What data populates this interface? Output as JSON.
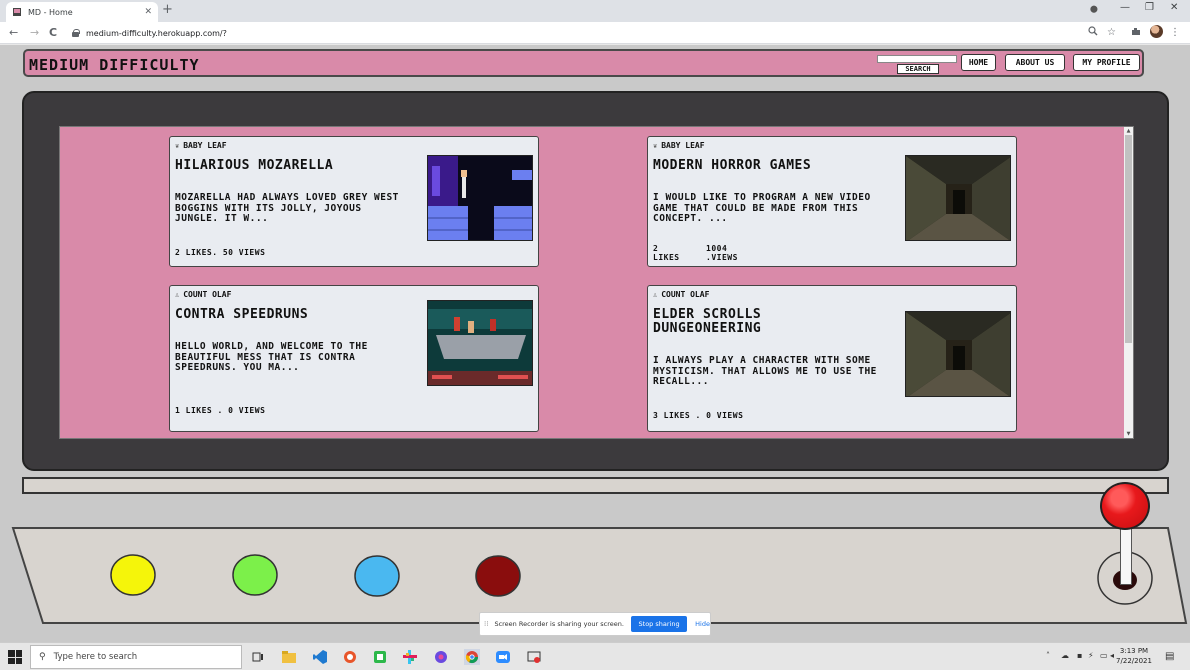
{
  "browser": {
    "tab_title": "MD - Home",
    "tab_close": "✕",
    "new_tab": "+",
    "url": "medium-difficulty.herokuapp.com/?",
    "back": "←",
    "forward": "→",
    "reload": "C",
    "win_min": "—",
    "win_max": "❐",
    "win_close": "✕",
    "minimize_tab": "⬤"
  },
  "navbar": {
    "brand": "MEDIUM DIFFICULTY",
    "search_placeholder": "",
    "search_label": "SEARCH",
    "links": [
      "HOME",
      "ABOUT US",
      "MY PROFILE"
    ]
  },
  "posts": [
    {
      "author": "BABY LEAF",
      "author_icon": "leaf-icon",
      "title": "HILARIOUS MOZARELLA",
      "excerpt": "MOZARELLA HAD ALWAYS LOVED GREY WEST BOGGINS WITH ITS JOLLY, JOYOUS JUNGLE. IT W...",
      "stats": "2 LIKES. 50 VIEWS",
      "thumbnail": "prince-of-persia-screenshot"
    },
    {
      "author": "BABY LEAF",
      "author_icon": "leaf-icon",
      "title": "MODERN HORROR GAMES",
      "excerpt": "I WOULD LIKE TO PROGRAM A NEW VIDEO GAME THAT COULD BE MADE FROM THIS CONCEPT. ...",
      "stats_likes": "2\nLIKES",
      "stats_views": "1004\n.VIEWS",
      "thumbnail": "dungeon-corridor-screenshot"
    },
    {
      "author": "COUNT OLAF",
      "author_icon": "person-icon",
      "title": "CONTRA SPEEDRUNS",
      "excerpt": "HELLO WORLD, AND WELCOME TO THE BEAUTIFUL MESS THAT IS CONTRA SPEEDRUNS. YOU MA...",
      "stats": "1 LIKES . 0 VIEWS",
      "thumbnail": "contra-screenshot"
    },
    {
      "author": "COUNT OLAF",
      "author_icon": "person-icon",
      "title": "ELDER SCROLLS DUNGEONEERING",
      "excerpt": "I ALWAYS PLAY A CHARACTER WITH SOME MYSTICISM. THAT ALLOWS ME TO USE THE RECALL...",
      "stats": "3 LIKES . 0 VIEWS",
      "thumbnail": "dungeon-corridor-screenshot"
    }
  ],
  "arcade": {
    "button_colors": [
      "#f5f50a",
      "#7cf04a",
      "#4ab8f0",
      "#8a0d0d"
    ],
    "joystick_color": "#e8191c"
  },
  "share_banner": {
    "grip": "⁞⁞",
    "message": "Screen Recorder is sharing your screen.",
    "stop_label": "Stop sharing",
    "hide_label": "Hide"
  },
  "taskbar": {
    "search_placeholder": "Type here to search",
    "time": "3:13 PM",
    "date": "7/22/2021"
  }
}
